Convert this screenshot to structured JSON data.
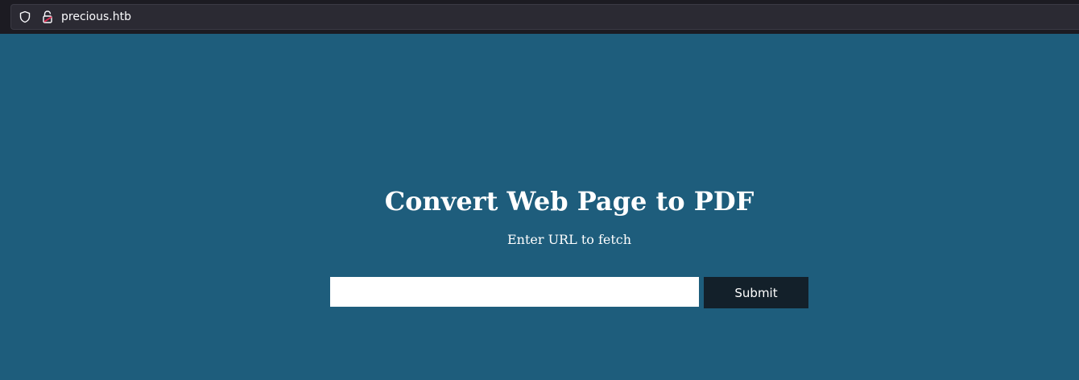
{
  "browser": {
    "url": "precious.htb",
    "icons": {
      "shield": "shield-icon",
      "lock": "lock-icon"
    }
  },
  "page": {
    "title": "Convert Web Page to PDF",
    "subtitle": "Enter URL to fetch",
    "url_input": {
      "value": "",
      "placeholder": ""
    },
    "submit_label": "Submit"
  },
  "colors": {
    "page_background": "#1e5d7c",
    "button_background": "#13202a",
    "toolbar_background": "#1c1b22"
  }
}
